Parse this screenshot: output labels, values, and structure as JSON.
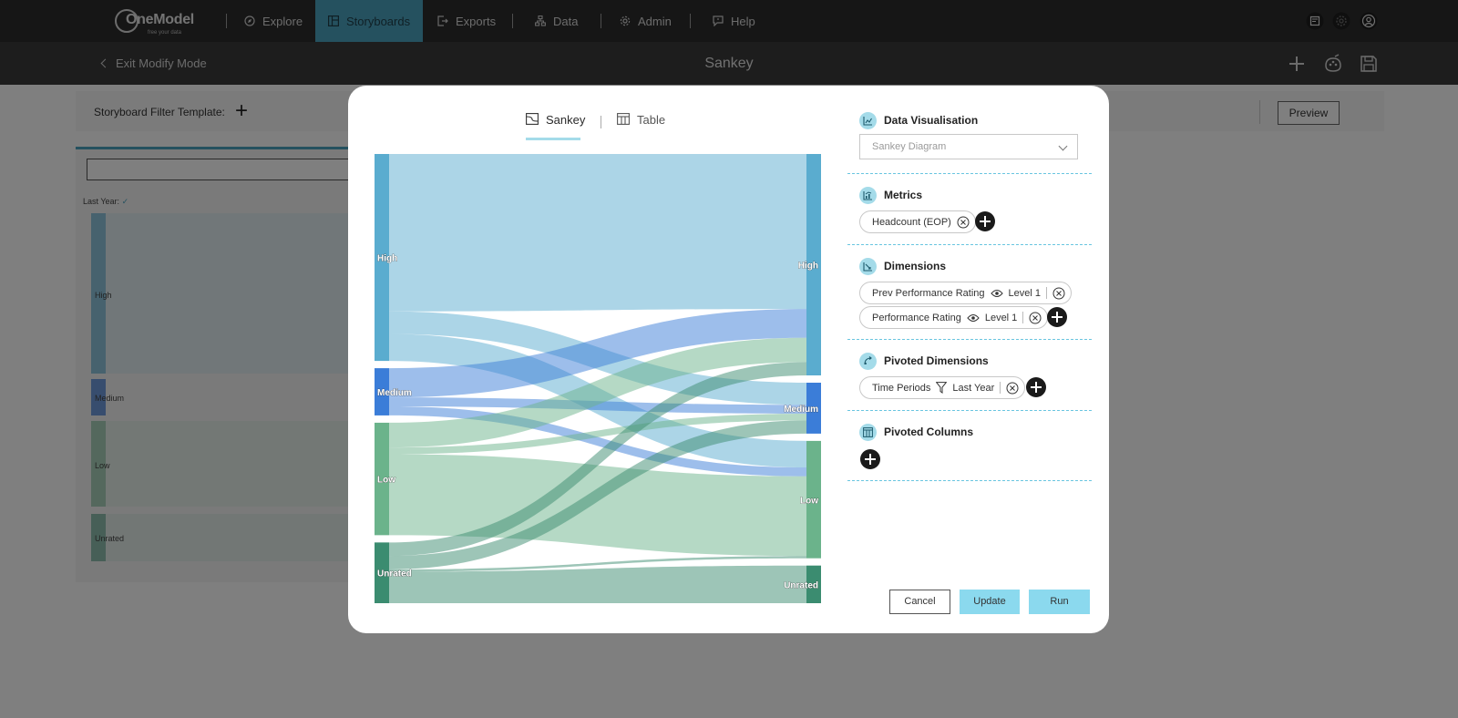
{
  "app": {
    "logo_name": "OneModel",
    "logo_tagline": "free your data"
  },
  "nav": {
    "items": [
      {
        "label": "Explore",
        "icon": "compass-icon"
      },
      {
        "label": "Storyboards",
        "icon": "storyboard-icon",
        "active": true
      },
      {
        "label": "Exports",
        "icon": "export-icon"
      },
      {
        "label": "Data",
        "icon": "data-icon"
      },
      {
        "label": "Admin",
        "icon": "gear-icon"
      },
      {
        "label": "Help",
        "icon": "help-icon"
      }
    ],
    "right_icons": [
      "news-icon",
      "settings-icon",
      "user-icon"
    ]
  },
  "subbar": {
    "exit_label": "Exit Modify Mode",
    "title": "Sankey",
    "icons": [
      "add-icon",
      "palette-icon",
      "save-icon"
    ]
  },
  "background": {
    "filter_label": "Storyboard Filter Template:",
    "preview_label": "Preview",
    "tile_label": "Last Year:",
    "tile_nodes": [
      "High",
      "Medium",
      "Low",
      "Unrated"
    ]
  },
  "modal": {
    "tabs": [
      {
        "label": "Sankey",
        "icon": "sankey-icon",
        "active": true
      },
      {
        "label": "Table",
        "icon": "table-icon"
      }
    ],
    "sections": {
      "data_visualisation": {
        "title": "Data Visualisation",
        "icon": "chart-icon",
        "value": "Sankey Diagram"
      },
      "metrics": {
        "title": "Metrics",
        "icon": "metric-icon",
        "items": [
          "Headcount (EOP)"
        ]
      },
      "dimensions": {
        "title": "Dimensions",
        "icon": "dimension-icon",
        "items": [
          {
            "label": "Prev Performance Rating",
            "level": "Level 1"
          },
          {
            "label": "Performance Rating",
            "level": "Level 1"
          }
        ]
      },
      "pivoted_dimensions": {
        "title": "Pivoted Dimensions",
        "icon": "pivot-icon",
        "items": [
          {
            "label": "Time Periods",
            "filter": "Last Year"
          }
        ]
      },
      "pivoted_columns": {
        "title": "Pivoted Columns",
        "icon": "columns-icon",
        "items": []
      }
    },
    "buttons": {
      "cancel": "Cancel",
      "update": "Update",
      "run": "Run"
    }
  },
  "chart_data": {
    "type": "sankey",
    "left_nodes": [
      {
        "name": "High",
        "value": 46,
        "color": "#5aaccf"
      },
      {
        "name": "Medium",
        "value": 10.5,
        "color": "#3b7dd8"
      },
      {
        "name": "Low",
        "value": 25,
        "color": "#6bb38b"
      },
      {
        "name": "Unrated",
        "value": 13.5,
        "color": "#3b8c70"
      }
    ],
    "right_nodes": [
      {
        "name": "High",
        "value": 50,
        "color": "#5aaccf"
      },
      {
        "name": "Medium",
        "value": 11.5,
        "color": "#3b7dd8"
      },
      {
        "name": "Low",
        "value": 26.5,
        "color": "#6bb38b"
      },
      {
        "name": "Unrated",
        "value": 8.5,
        "color": "#3b8c70"
      }
    ],
    "links": [
      {
        "source": "High",
        "target": "High",
        "value": 35
      },
      {
        "source": "High",
        "target": "Medium",
        "value": 5
      },
      {
        "source": "High",
        "target": "Low",
        "value": 6
      },
      {
        "source": "Medium",
        "target": "High",
        "value": 6.5
      },
      {
        "source": "Medium",
        "target": "Medium",
        "value": 2
      },
      {
        "source": "Medium",
        "target": "Low",
        "value": 2
      },
      {
        "source": "Low",
        "target": "High",
        "value": 5.5
      },
      {
        "source": "Low",
        "target": "Medium",
        "value": 1.5
      },
      {
        "source": "Low",
        "target": "Low",
        "value": 18
      },
      {
        "source": "Unrated",
        "target": "High",
        "value": 3
      },
      {
        "source": "Unrated",
        "target": "Medium",
        "value": 3
      },
      {
        "source": "Unrated",
        "target": "Low",
        "value": 0.5
      },
      {
        "source": "Unrated",
        "target": "Unrated",
        "value": 8.5
      }
    ]
  }
}
